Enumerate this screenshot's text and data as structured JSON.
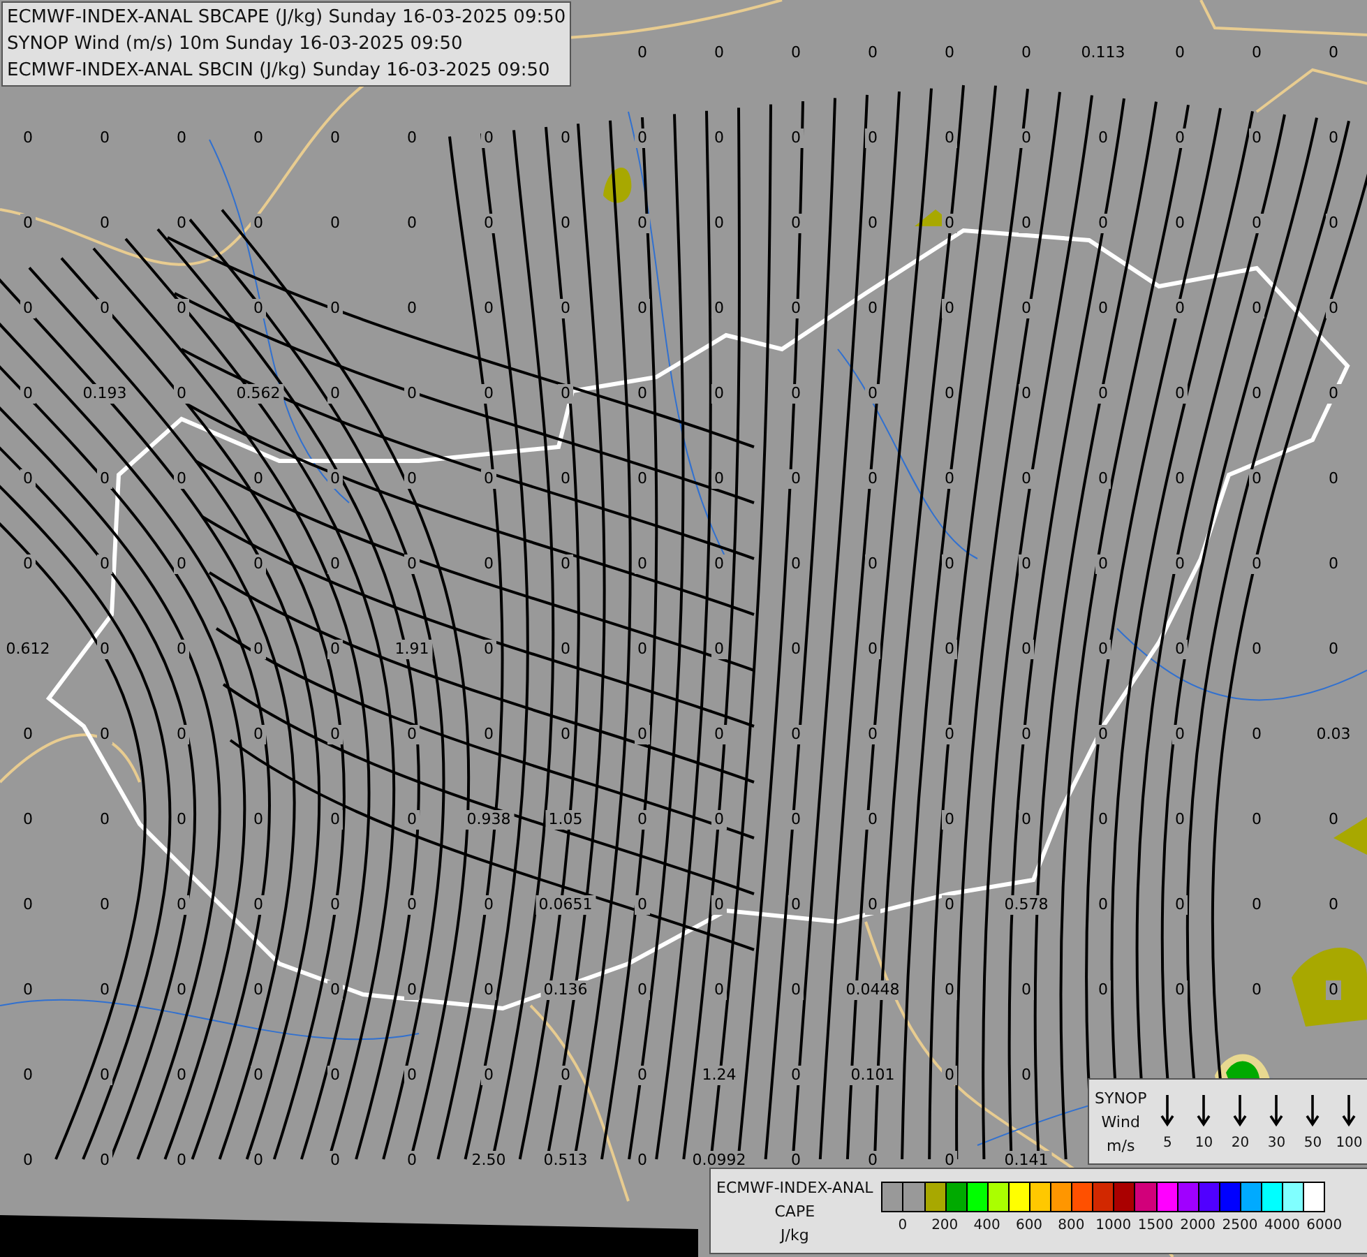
{
  "header": {
    "lines": [
      "ECMWF-INDEX-ANAL SBCAPE (J/kg) Sunday 16-03-2025 09:50",
      "SYNOP Wind (m/s) 10m Sunday 16-03-2025 09:50",
      "ECMWF-INDEX-ANAL SBCIN (J/kg) Sunday 16-03-2025 09:50"
    ]
  },
  "value_grid": [
    [
      "0",
      "0",
      "0",
      "0",
      "0",
      "0",
      "0.113",
      "0",
      "0",
      "0"
    ],
    [
      "0",
      "0",
      "0",
      "0",
      "0",
      "0",
      "0",
      "0",
      "0",
      "0",
      "0",
      "0",
      "0",
      "0",
      "0",
      "0",
      "0",
      "0"
    ],
    [
      "0",
      "0",
      "0",
      "0",
      "0",
      "0",
      "0",
      "0",
      "0",
      "0",
      "0",
      "0",
      "0",
      "0",
      "0",
      "0",
      "0",
      "0"
    ],
    [
      "0",
      "0",
      "0",
      "0",
      "0",
      "0",
      "0",
      "0",
      "0",
      "0",
      "0",
      "0",
      "0",
      "0",
      "0",
      "0",
      "0",
      "0"
    ],
    [
      "0",
      "0.193",
      "0",
      "0.562",
      "0",
      "0",
      "0",
      "0",
      "0",
      "0",
      "0",
      "0",
      "0",
      "0",
      "0",
      "0",
      "0",
      "0"
    ],
    [
      "0",
      "0",
      "0",
      "0",
      "0",
      "0",
      "0",
      "0",
      "0",
      "0",
      "0",
      "0",
      "0",
      "0",
      "0",
      "0",
      "0",
      "0"
    ],
    [
      "0",
      "0",
      "0",
      "0",
      "0",
      "0",
      "0",
      "0",
      "0",
      "0",
      "0",
      "0",
      "0",
      "0",
      "0",
      "0",
      "0",
      "0"
    ],
    [
      "0.612",
      "0",
      "0",
      "0",
      "0",
      "1.91",
      "0",
      "0",
      "0",
      "0",
      "0",
      "0",
      "0",
      "0",
      "0",
      "0",
      "0",
      "0"
    ],
    [
      "0",
      "0",
      "0",
      "0",
      "0",
      "0",
      "0",
      "0",
      "0",
      "0",
      "0",
      "0",
      "0",
      "0",
      "0",
      "0",
      "0",
      "0.03"
    ],
    [
      "0",
      "0",
      "0",
      "0",
      "0",
      "0",
      "0.938",
      "1.05",
      "0",
      "0",
      "0",
      "0",
      "0",
      "0",
      "0",
      "0",
      "0",
      "0"
    ],
    [
      "0",
      "0",
      "0",
      "0",
      "0",
      "0",
      "0",
      "0.0651",
      "0",
      "0",
      "0",
      "0",
      "0",
      "0.578",
      "0",
      "0",
      "0",
      "0"
    ],
    [
      "0",
      "0",
      "0",
      "0",
      "0",
      "0",
      "0",
      "0.136",
      "0",
      "0",
      "0",
      "0.0448",
      "0",
      "0",
      "0",
      "0",
      "0",
      "0"
    ],
    [
      "0",
      "0",
      "0",
      "0",
      "0",
      "0",
      "0",
      "0",
      "0",
      "1.24",
      "0",
      "0.101",
      "0",
      "0"
    ],
    [
      "0",
      "0",
      "0",
      "0",
      "0",
      "0",
      "2.50",
      "0.513",
      "0",
      "0.0992",
      "0",
      "0",
      "0",
      "0.141"
    ]
  ],
  "wind_legend": {
    "lines": [
      "SYNOP",
      "Wind",
      "m/s"
    ],
    "speeds": [
      "5",
      "10",
      "20",
      "30",
      "50",
      "100"
    ]
  },
  "cape_legend": {
    "lines": [
      "ECMWF-INDEX-ANAL",
      "CAPE",
      "J/kg"
    ],
    "colors": [
      {
        "color": "#999999"
      },
      {
        "color": "#999999"
      },
      {
        "color": "#a8a800"
      },
      {
        "color": "#00aa00"
      },
      {
        "color": "#00ff00"
      },
      {
        "color": "#aaff00"
      },
      {
        "color": "#ffff00"
      },
      {
        "color": "#ffc800"
      },
      {
        "color": "#ff9600"
      },
      {
        "color": "#ff5000"
      },
      {
        "color": "#d22800"
      },
      {
        "color": "#aa0000"
      },
      {
        "color": "#d2007a"
      },
      {
        "color": "#ff00ff"
      },
      {
        "color": "#a000ff"
      },
      {
        "color": "#5000ff"
      },
      {
        "color": "#0000ff"
      },
      {
        "color": "#00aaff"
      },
      {
        "color": "#00ffff"
      },
      {
        "color": "#80ffff"
      },
      {
        "color": "#ffffff"
      }
    ],
    "ticks": [
      "0",
      "200",
      "400",
      "600",
      "800",
      "1000",
      "1500",
      "2000",
      "2500",
      "4000",
      "6000"
    ]
  }
}
